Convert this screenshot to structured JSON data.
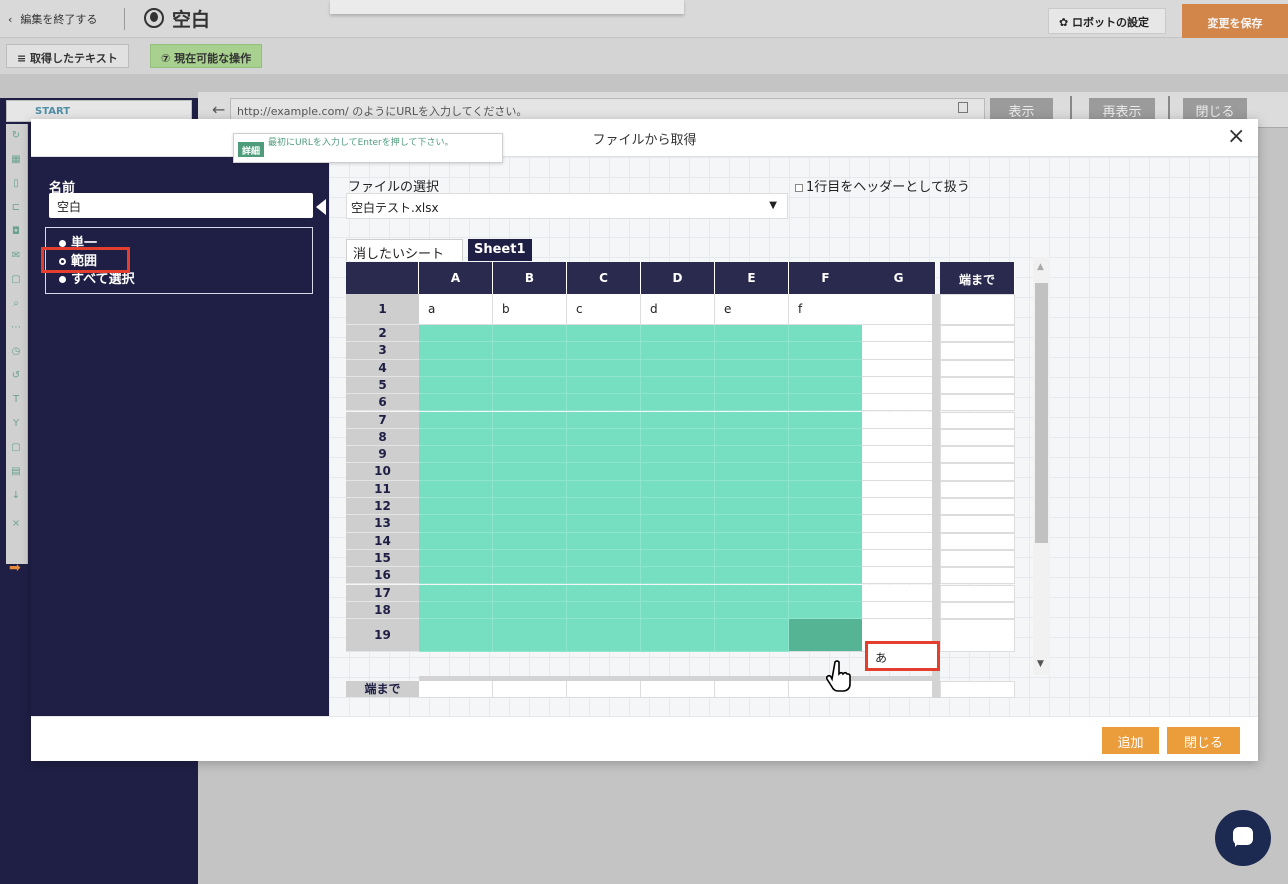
{
  "topbar": {
    "back_label": "編集を終了する",
    "robot_title": "空白",
    "robot_settings_label": "ロボットの設定",
    "save_label": "変更を保存"
  },
  "subbar": {
    "acquired_text_label": "取得したテキスト",
    "ops_label": "現在可能な操作"
  },
  "start_label": "START",
  "url_bar": {
    "placeholder": "http://example.com/ のようにURLを入力してください。",
    "show_label": "表示",
    "reload_label": "再表示",
    "close_label": "閉じる"
  },
  "tooltip": {
    "badge": "詳細",
    "text": "最初にURLを入力してEnterを押して下さい。"
  },
  "modal": {
    "title": "ファイルから取得",
    "close_icon": "×",
    "name_label": "名前",
    "name_value": "空白",
    "options": [
      "単一",
      "範囲",
      "すべて選択"
    ],
    "selected_option": "範囲",
    "file_label": "ファイルの選択",
    "file_value": "空白テスト.xlsx",
    "header_option_label": "1行目をヘッダーとして扱う",
    "header_option_checked": false,
    "sheet_tabs": [
      "消したいシート",
      "Sheet1"
    ],
    "active_sheet": "Sheet1",
    "add_label": "追加",
    "close_label": "閉じる"
  },
  "grid": {
    "columns": [
      "A",
      "B",
      "C",
      "D",
      "E",
      "F",
      "G"
    ],
    "to_end_col": "端まで",
    "rows": [
      "1",
      "2",
      "3",
      "4",
      "5",
      "6",
      "7",
      "8",
      "9",
      "10",
      "11",
      "12",
      "13",
      "14",
      "15",
      "16",
      "17",
      "18",
      "19"
    ],
    "to_end_row": "端まで",
    "row1_values": [
      "a",
      "b",
      "c",
      "d",
      "e",
      "f",
      ""
    ],
    "g19_value": "あ",
    "selection": {
      "from": "A2",
      "to": "F19"
    }
  },
  "icons": {
    "back": "chevron-left-icon",
    "robot": "robot-icon",
    "settings": "gear-icon",
    "list": "list-icon",
    "help": "help-circle-icon",
    "url_back": "arrow-left-icon",
    "copy": "copy-icon",
    "chat": "chat-icon",
    "cursor": "hand-pointer-icon"
  },
  "colors": {
    "brand_dark": "#1f1f46",
    "selection": "#77dfc1",
    "selection_dark": "#55b494",
    "accent_orange": "#eb9d3c",
    "highlight_red": "#e43e2e",
    "ops_green": "#a8d18f"
  }
}
